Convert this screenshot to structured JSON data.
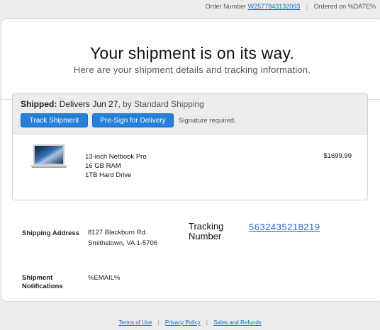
{
  "header": {
    "order_label": "Order Number",
    "order_number": "W2577843132093",
    "ordered_on": "Ordered on %DATE%"
  },
  "hero": {
    "title": "Your shipment is on its way.",
    "subtitle": "Here are your shipment details and tracking information."
  },
  "shipment": {
    "status_label": "Shipped:",
    "delivers": "Delivers Jun 27,",
    "method": "by Standard Shipping",
    "track_button": "Track Shipment",
    "presign_button": "Pre-Sign for Delivery",
    "signature_note": "Signature required."
  },
  "item": {
    "lines": [
      "13-inch Netbook Pro",
      "16 GB RAM",
      "1TB Hard Drive"
    ],
    "price": "$1699.99"
  },
  "details": {
    "shipping_address_label": "Shipping Address",
    "address_lines": [
      "8127 Blackburn Rd.",
      "Smithstown, VA 1-5706"
    ],
    "tracking_label_lines": [
      "Tracking",
      "Number"
    ],
    "tracking_number": "5632435218219",
    "notifications_label_lines": [
      "Shipment",
      "Notifications"
    ],
    "notifications_value": "%EMAIL%"
  },
  "footer": {
    "terms": "Terms of Use",
    "privacy": "Privacy Policy",
    "sales": "Sales and Refunds"
  },
  "colors": {
    "accent": "#2480d8",
    "link": "#1a6bc4",
    "page_bg": "#ececec"
  }
}
